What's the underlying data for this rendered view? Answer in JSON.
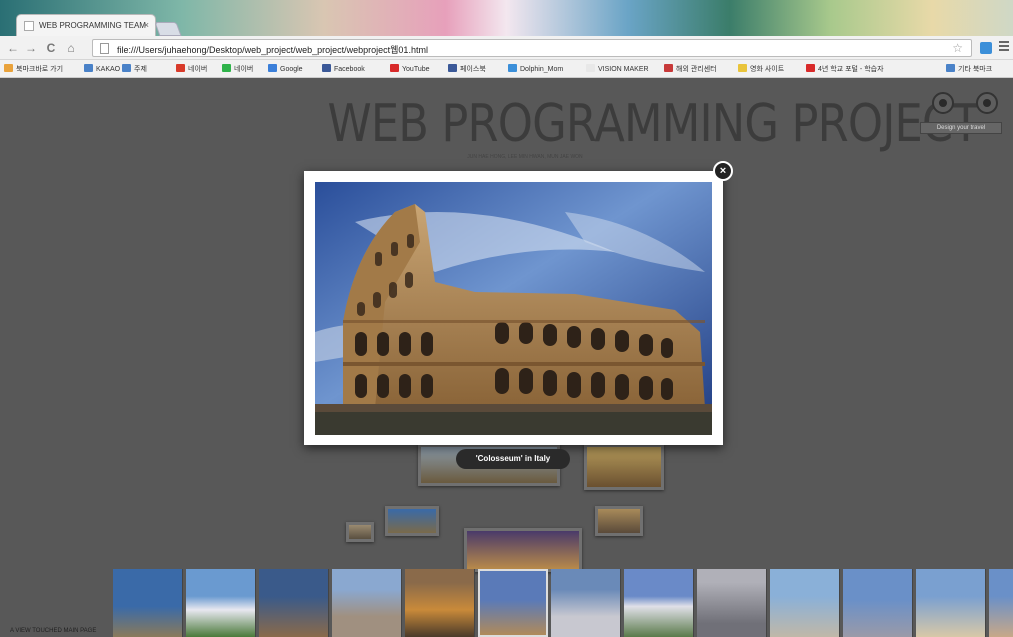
{
  "browser": {
    "tab_title": "WEB PROGRAMMING TEAM",
    "tab_close": "×",
    "back": "←",
    "forward": "→",
    "reload": "C",
    "home": "⌂",
    "url": "file:///Users/juhaehong/Desktop/web_project/web_project/webproject웹01.html",
    "star": "☆"
  },
  "bookmarks": [
    {
      "label": "북마크바로 가기",
      "color": "#e9a23b"
    },
    {
      "label": "KAKAO",
      "color": "#4a82c8"
    },
    {
      "label": "주제",
      "color": "#4a82c8"
    },
    {
      "label": "네이버",
      "color": "#d83a2a"
    },
    {
      "label": "네이버",
      "color": "#2fb34a"
    },
    {
      "label": "Google",
      "color": "#3b7fd9"
    },
    {
      "label": "Facebook",
      "color": "#3b5998"
    },
    {
      "label": "YouTube",
      "color": "#d82a2a"
    },
    {
      "label": "페이스북",
      "color": "#3b5998"
    },
    {
      "label": "Dolphin_Mom",
      "color": "#3b8fd9"
    },
    {
      "label": "VISION MAKER",
      "color": "#e8e8e8"
    },
    {
      "label": "해외 관리센터",
      "color": "#c83a3a"
    },
    {
      "label": "영화 사이트",
      "color": "#e9c43b"
    },
    {
      "label": "4년 학교 포털 - 학습자",
      "color": "#d82a2a"
    },
    {
      "label": "기타 북마크",
      "color": "#4a82c8"
    }
  ],
  "site": {
    "title": "WEB PROGRAMMING PROJECT",
    "subtitle": "JUN HAE HONG, LEE MIN HWAN, MUN JAE WON",
    "design_button": "Design your travel"
  },
  "lightbox": {
    "close": "×",
    "caption": "'Colosseum' in Italy"
  },
  "colors": {
    "page_bg": "#585858",
    "title": "#3c3c3c",
    "caption_bg": "#2a2a2a"
  },
  "filmstrip_count": 13,
  "status_text": "A VIEW TOUCHED MAIN PAGE"
}
